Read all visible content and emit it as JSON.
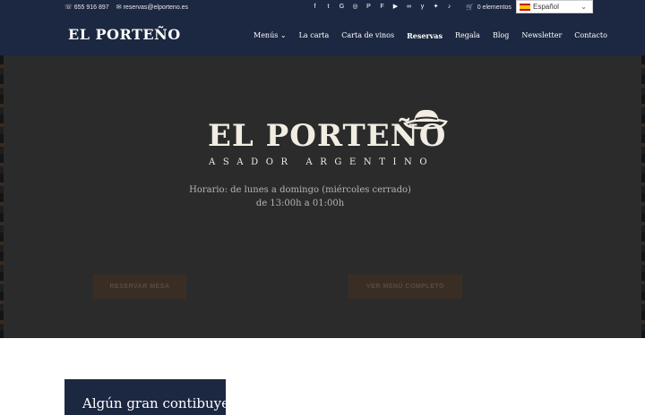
{
  "topbar": {
    "phone": "655 916 897",
    "email": "reservas@elporteno.es",
    "social_icons": [
      "facebook-icon",
      "twitter-icon",
      "google-plus-icon",
      "instagram-icon",
      "pinterest-icon",
      "foursquare-icon",
      "youtube-icon",
      "tripadvisor-icon",
      "yelp-icon",
      "bluesky-icon",
      "tiktok-icon"
    ],
    "cart_label": "0 elementos",
    "language": "Español"
  },
  "nav": {
    "logo": "EL PORTEÑO",
    "items": [
      "Menús",
      "La carta",
      "Carta de vinos",
      "Reservas",
      "Regala",
      "Blog",
      "Newsletter",
      "Contacto"
    ]
  },
  "hero": {
    "title": "EL PORTEÑO",
    "subtitle": "ASADOR ARGENTINO",
    "hours_line1": "Horario: de lunes a domingo (miércoles cerrado)",
    "hours_line2": "de 13:00h a 01:00h",
    "button_reserve": "Reservar mesa",
    "button_menu": "Ver menú completo"
  },
  "section": {
    "card_title": "Algún gran contibuye"
  },
  "colors": {
    "navy": "#1c2841",
    "hero_bg": "#2b2b2b",
    "button_bg": "#3a2e24"
  }
}
